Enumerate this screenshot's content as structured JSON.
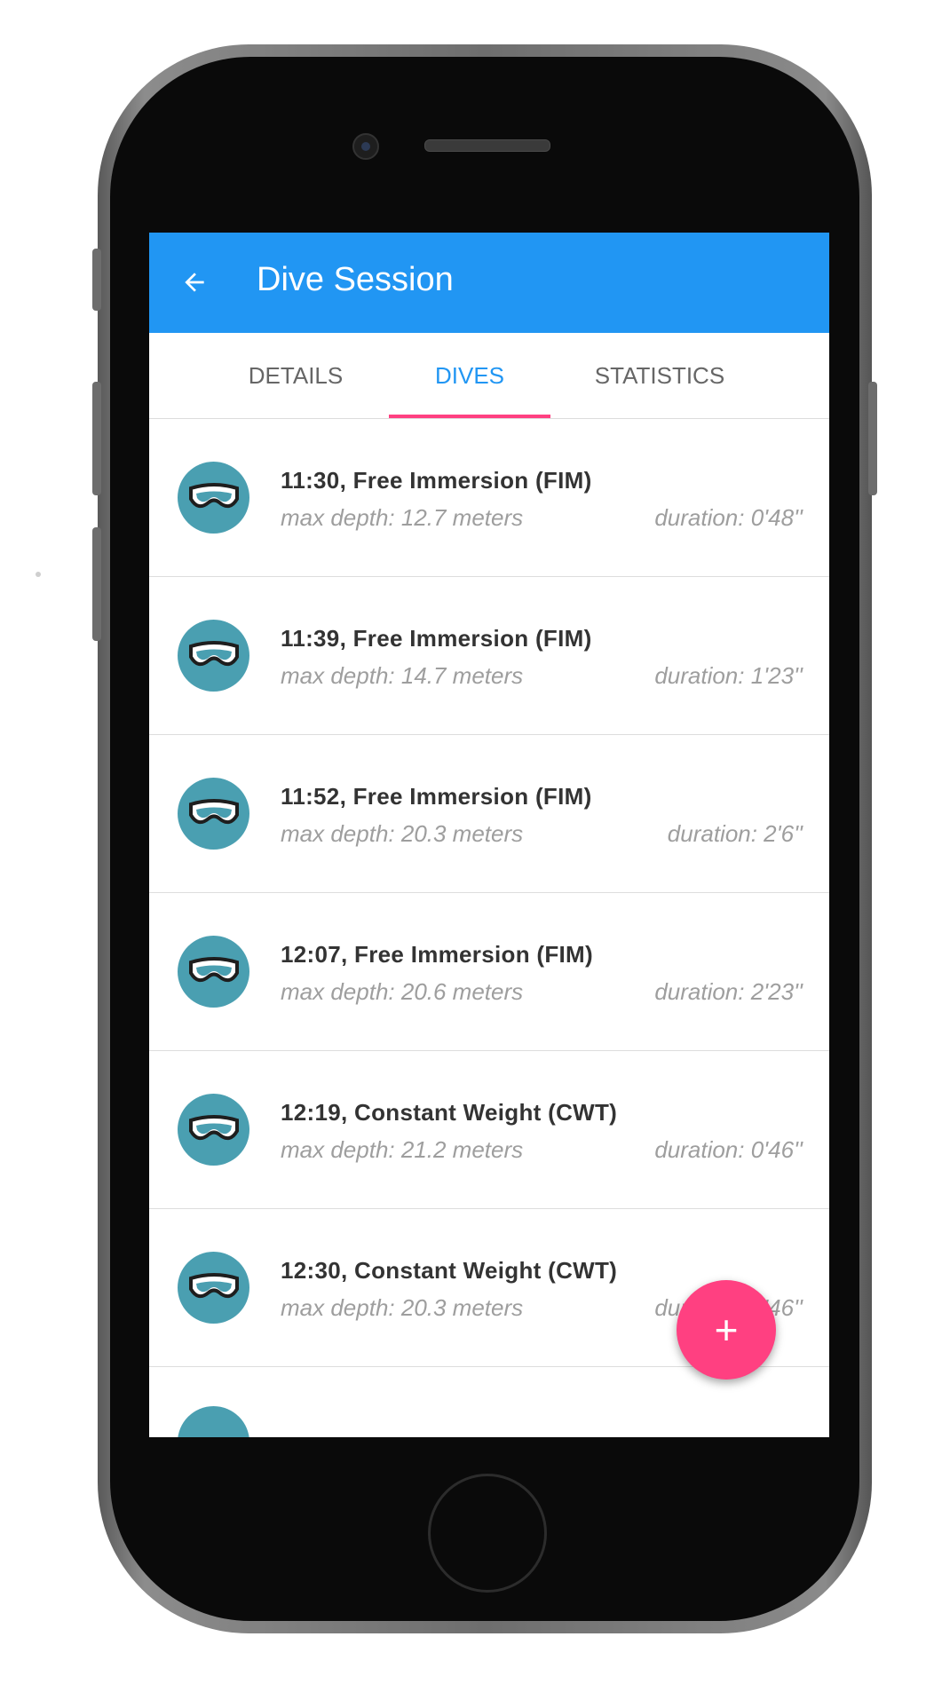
{
  "app": {
    "title": "Dive Session",
    "back_icon": "arrow-back-icon",
    "accent": "#2196f3",
    "tab_indicator_color": "#ff4081"
  },
  "tabs": [
    {
      "label": "DETAILS",
      "active": false
    },
    {
      "label": "DIVES",
      "active": true
    },
    {
      "label": "STATISTICS",
      "active": false
    }
  ],
  "dives": [
    {
      "title": "11:30, Free Immersion (FIM)",
      "depth": "max depth: 12.7 meters",
      "duration": "duration: 0'48''",
      "icon": "dive-mask-icon"
    },
    {
      "title": "11:39, Free Immersion (FIM)",
      "depth": "max depth: 14.7 meters",
      "duration": "duration: 1'23''",
      "icon": "dive-mask-icon"
    },
    {
      "title": "11:52, Free Immersion (FIM)",
      "depth": "max depth: 20.3 meters",
      "duration": "duration: 2'6''",
      "icon": "dive-mask-icon"
    },
    {
      "title": "12:07, Free Immersion (FIM)",
      "depth": "max depth: 20.6 meters",
      "duration": "duration: 2'23''",
      "icon": "dive-mask-icon"
    },
    {
      "title": "12:19, Constant Weight (CWT)",
      "depth": "max depth: 21.2 meters",
      "duration": "duration: 0'46''",
      "icon": "dive-mask-icon"
    },
    {
      "title": "12:30, Constant Weight (CWT)",
      "depth": "max depth: 20.3 meters",
      "duration": "duration: 0'46''",
      "icon": "dive-mask-icon"
    }
  ],
  "fab": {
    "label": "+",
    "icon": "add-icon",
    "color": "#ff4081"
  },
  "avatar_color": "#4a9fb1"
}
